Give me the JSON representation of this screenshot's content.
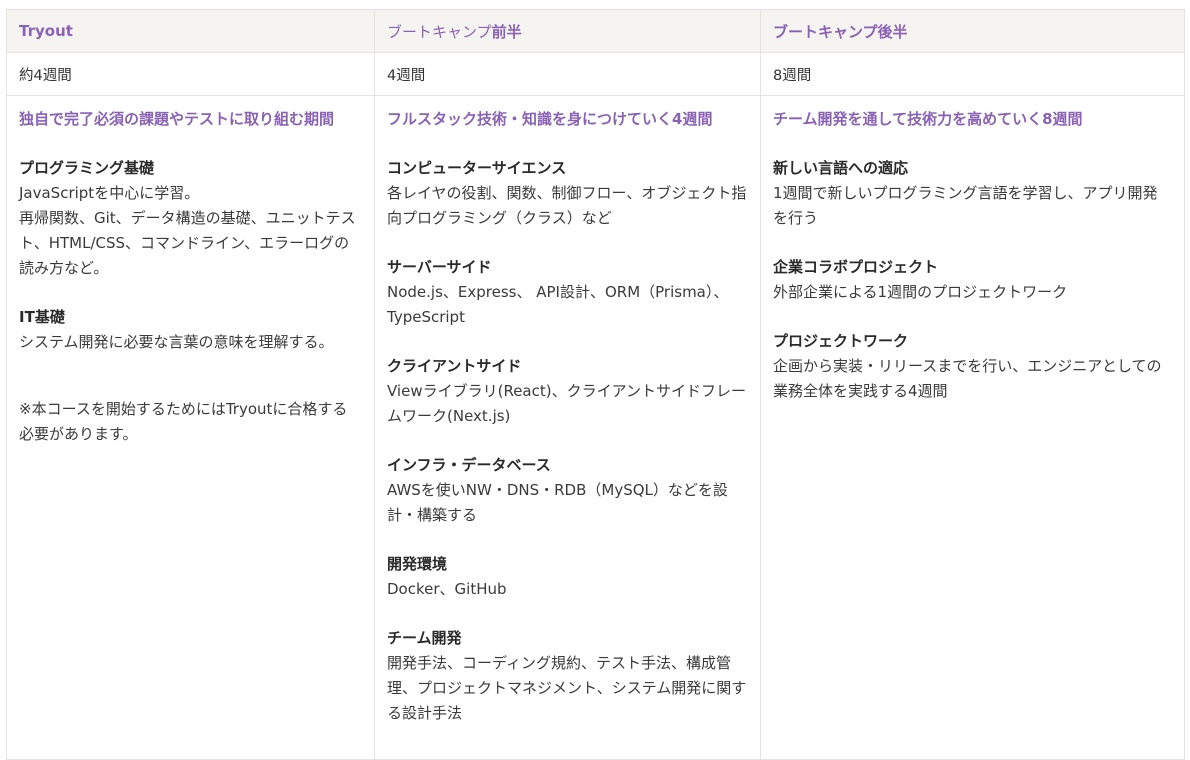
{
  "header": {
    "col1": "Tryout",
    "col2_light": "ブートキャンプ",
    "col2_bold": "前半",
    "col3": "ブートキャンプ後半"
  },
  "durations": {
    "col1": "約4週間",
    "col2": "4週間",
    "col3": "8週間"
  },
  "tryout": {
    "lead": "独自で完了必須の課題やテストに取り組む期間",
    "sections": [
      {
        "title": "プログラミング基礎",
        "desc": "JavaScriptを中心に学習。\n再帰関数、Git、データ構造の基礎、ユニットテスト、HTML/CSS、コマンドライン、エラーログの読み方など。"
      },
      {
        "title": "IT基礎",
        "desc": "システム開発に必要な言葉の意味を理解する。"
      }
    ],
    "note": "※本コースを開始するためにはTryoutに合格する必要があります。"
  },
  "first_half": {
    "lead": "フルスタック技術・知識を身につけていく4週間",
    "sections": [
      {
        "title": "コンピューターサイエンス",
        "desc": "各レイヤの役割、関数、制御フロー、オブジェクト指向プログラミング（クラス）など"
      },
      {
        "title": "サーバーサイド",
        "desc": "Node.js、Express、 API設計、ORM（Prisma）、TypeScript"
      },
      {
        "title": "クライアントサイド",
        "desc": "Viewライブラリ(React)、クライアントサイドフレームワーク(Next.js)"
      },
      {
        "title": "インフラ・データベース",
        "desc": "AWSを使いNW・DNS・RDB（MySQL）などを設計・構築する"
      },
      {
        "title": "開発環境",
        "desc": "Docker、GitHub"
      },
      {
        "title": "チーム開発",
        "desc": "開発手法、コーディング規約、テスト手法、構成管理、プロジェクトマネジメント、システム開発に関する設計手法"
      }
    ]
  },
  "second_half": {
    "lead": "チーム開発を通して技術力を高めていく8週間",
    "sections": [
      {
        "title": "新しい言語への適応",
        "desc": "1週間で新しいプログラミング言語を学習し、アプリ開発を行う"
      },
      {
        "title": "企業コラボプロジェクト",
        "desc": "外部企業による1週間のプロジェクトワーク"
      },
      {
        "title": "プロジェクトワーク",
        "desc": "企画から実装・リリースまでを行い、エンジニアとしての業務全体を実践する4週間"
      }
    ]
  },
  "colors": {
    "accent": "#8a62b5",
    "header_bg": "#f5f4f1",
    "border": "#e3e3e3"
  }
}
